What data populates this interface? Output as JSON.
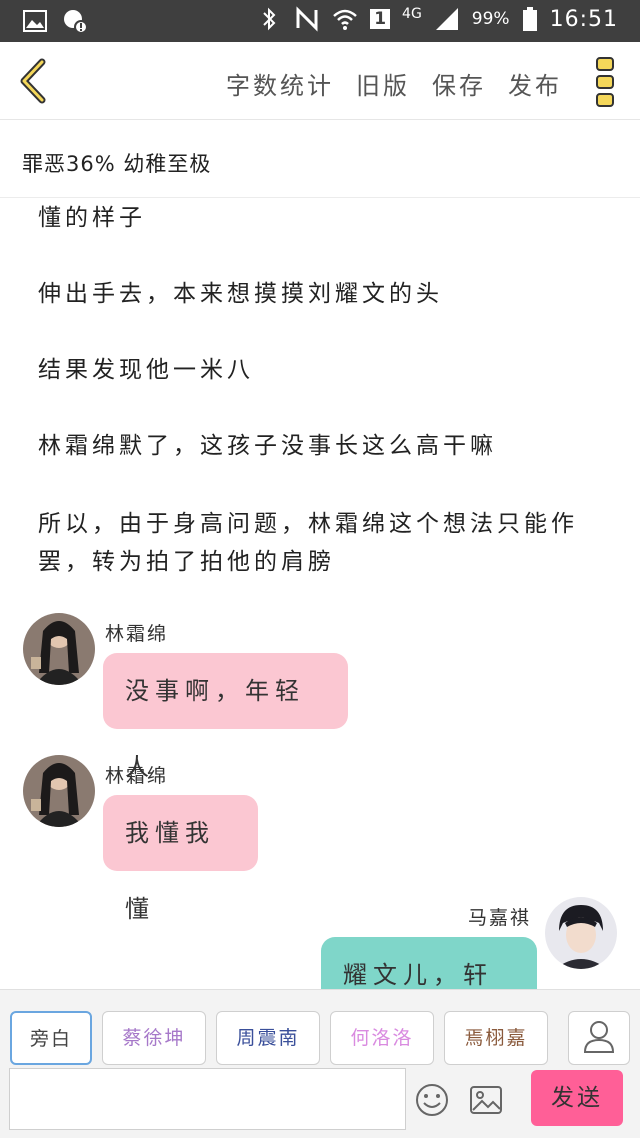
{
  "status_bar": {
    "network": "4G",
    "sim": "1",
    "battery": "99%",
    "time": "16:51"
  },
  "toolbar": {
    "actions": [
      "字数统计",
      "旧版",
      "保存",
      "发布"
    ]
  },
  "chapter": {
    "title": "罪恶36% 幼稚至极"
  },
  "story": {
    "paragraphs": [
      "懂的样子",
      "伸出手去，本来想摸摸刘耀文的头",
      "结果发现他一米八",
      "林霜绵默了，这孩子没事长这么高干嘛",
      "所以，由于身高问题，林霜绵这个想法只能作罢，转为拍了拍他的肩膀"
    ],
    "messages": [
      {
        "speaker": "林霜绵",
        "text": "没事啊，年轻人"
      },
      {
        "speaker": "林霜绵",
        "text": "我懂我懂"
      },
      {
        "speaker": "马嘉祺",
        "text": "耀文儿，轩儿"
      }
    ]
  },
  "input_bar": {
    "roles": [
      {
        "label": "旁白",
        "color": "#444444"
      },
      {
        "label": "蔡徐坤",
        "color": "#a678c9"
      },
      {
        "label": "周震南",
        "color": "#3a4f9a"
      },
      {
        "label": "何洛洛",
        "color": "#d98be0"
      },
      {
        "label": "焉栩嘉",
        "color": "#8a5a3c"
      }
    ],
    "text_value": "",
    "send_label": "发送",
    "accent": "#ff5f97"
  }
}
